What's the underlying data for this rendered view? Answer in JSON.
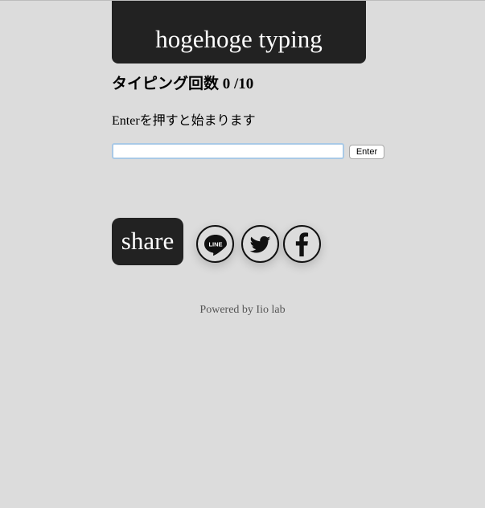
{
  "header": {
    "title": "hogehoge typing"
  },
  "counter": {
    "text": "タイピング回数 0 /10"
  },
  "message": {
    "text": "Enterを押すと始まります"
  },
  "input": {
    "value": "",
    "placeholder": ""
  },
  "enter_button": {
    "label": "Enter"
  },
  "share": {
    "label": "share",
    "icons": [
      "line-icon",
      "twitter-icon",
      "facebook-icon"
    ],
    "line_text": "LINE"
  },
  "footer": {
    "text": "Powered by Iio lab"
  },
  "colors": {
    "background": "#dcdcdc",
    "dark_panel": "#222222",
    "input_focus_border": "#a9c9e6"
  }
}
